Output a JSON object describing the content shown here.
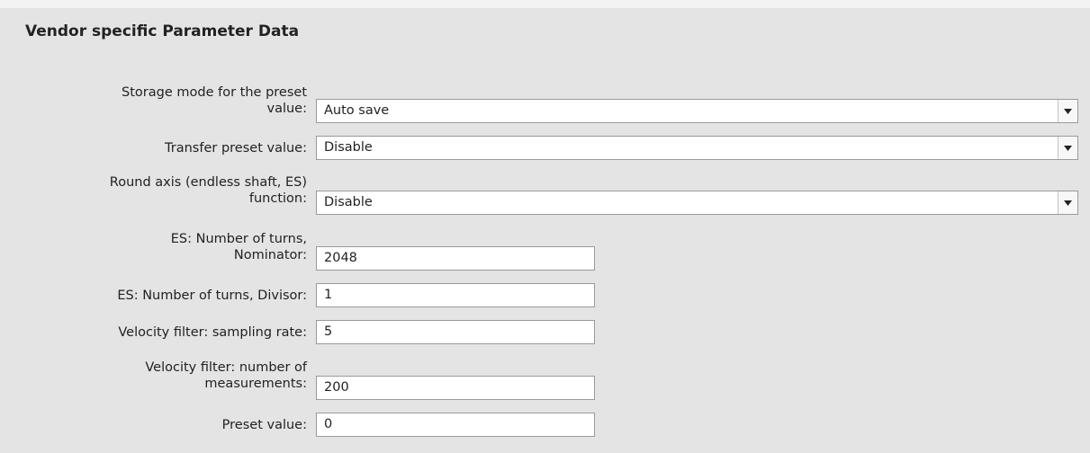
{
  "section": {
    "title": "Vendor specific Parameter Data"
  },
  "params": {
    "storage_mode": {
      "label_line1": "Storage mode for the preset",
      "label_line2": "value:",
      "value": "Auto save"
    },
    "transfer_preset": {
      "label": "Transfer preset value:",
      "value": "Disable"
    },
    "round_axis": {
      "label_line1": "Round axis (endless shaft, ES)",
      "label_line2": "function:",
      "value": "Disable"
    },
    "es_nominator": {
      "label_line1": "ES: Number of turns,",
      "label_line2": "Nominator:",
      "value": "2048"
    },
    "es_divisor": {
      "label": "ES: Number of turns, Divisor:",
      "value": "1"
    },
    "velocity_sampling_rate": {
      "label": "Velocity filter: sampling rate:",
      "value": "5"
    },
    "velocity_measurements": {
      "label_line1": "Velocity filter: number of",
      "label_line2": "measurements:",
      "value": "200"
    },
    "preset_value": {
      "label": "Preset value:",
      "value": "0"
    }
  },
  "icons": {
    "dropdown": "chevron-down-icon"
  },
  "colors": {
    "panel_background": "#e4e4e4",
    "field_background": "#ffffff",
    "field_border": "#9a9a9a"
  }
}
